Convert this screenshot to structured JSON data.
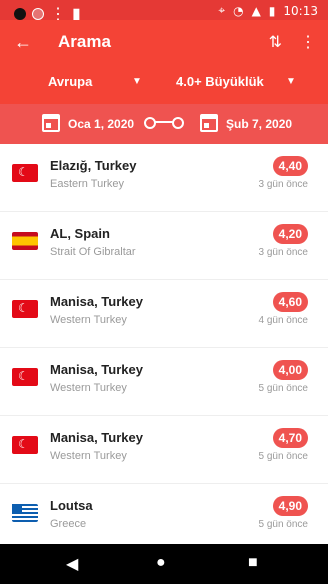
{
  "statusbar": {
    "time": "10:13"
  },
  "toolbar": {
    "title": "Arama"
  },
  "filters": {
    "region": "Avrupa",
    "magnitude": "4.0+ Büyüklük"
  },
  "daterange": {
    "from": "Oca 1, 2020",
    "to": "Şub 7, 2020"
  },
  "earthquakes": [
    {
      "location": "Elazığ, Turkey",
      "region": "Eastern Turkey",
      "magnitude": "4,40",
      "ago": "3 gün önce",
      "flag": "tr"
    },
    {
      "location": "AL, Spain",
      "region": "Strait Of Gibraltar",
      "magnitude": "4,20",
      "ago": "3 gün önce",
      "flag": "es"
    },
    {
      "location": "Manisa, Turkey",
      "region": "Western Turkey",
      "magnitude": "4,60",
      "ago": "4 gün önce",
      "flag": "tr"
    },
    {
      "location": "Manisa, Turkey",
      "region": "Western Turkey",
      "magnitude": "4,00",
      "ago": "5 gün önce",
      "flag": "tr"
    },
    {
      "location": "Manisa, Turkey",
      "region": "Western Turkey",
      "magnitude": "4,70",
      "ago": "5 gün önce",
      "flag": "tr"
    },
    {
      "location": "Loutsa",
      "region": "Greece",
      "magnitude": "4,90",
      "ago": "5 gün önce",
      "flag": "gr"
    }
  ]
}
